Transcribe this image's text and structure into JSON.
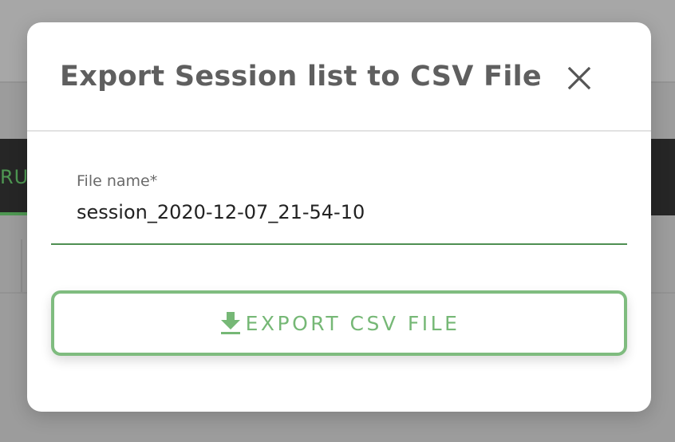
{
  "background": {
    "tab_label": "RU"
  },
  "dialog": {
    "title": "Export Session list to CSV File",
    "close_icon": "close-icon",
    "field": {
      "label": "File name*",
      "value": "session_2020-12-07_21-54-10"
    },
    "export_button": {
      "label": "EXPORT CSV FILE",
      "icon": "download-icon"
    }
  },
  "colors": {
    "accent": "#7fbc7f",
    "underline": "#4e8f52",
    "title": "#5f5f5f",
    "overlay": "#9c9c9c"
  }
}
